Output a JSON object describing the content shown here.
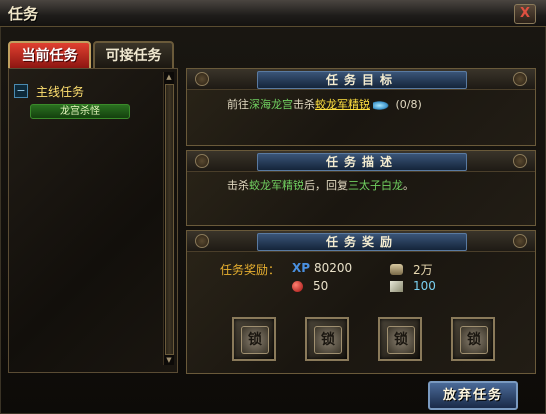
{
  "window": {
    "title": "任务",
    "close_label": "X"
  },
  "tabs": [
    {
      "label": "当前任务",
      "active": true
    },
    {
      "label": "可接任务",
      "active": false
    }
  ],
  "quest_tree": {
    "category_toggle": "−",
    "category_label": "主线任务",
    "quests": [
      "龙宫杀怪"
    ]
  },
  "objective": {
    "header": "任务目标",
    "prefix": "前往",
    "location": "深海龙宫",
    "action": "击杀",
    "target": "蛟龙军精锐",
    "progress": "(0/8)"
  },
  "description": {
    "header": "任务描述",
    "text_before": "击杀",
    "target": "蛟龙军精锐",
    "text_middle": "后，回复",
    "npc": "三太子白龙",
    "text_end": "。"
  },
  "rewards": {
    "header": "任务奖励",
    "label": "任务奖励：",
    "xp_icon": "XP",
    "xp": "80200",
    "money": "2万",
    "orb": "50",
    "gift": "100",
    "slot_glyph": "锁",
    "slots": 4
  },
  "buttons": {
    "abandon": "放弃任务"
  },
  "colors": {
    "accent_red": "#c02818",
    "quest_green": "#70d060",
    "highlight_yellow": "#ffe040",
    "reward_orange": "#e8b030",
    "xp_blue": "#4a90e0"
  }
}
